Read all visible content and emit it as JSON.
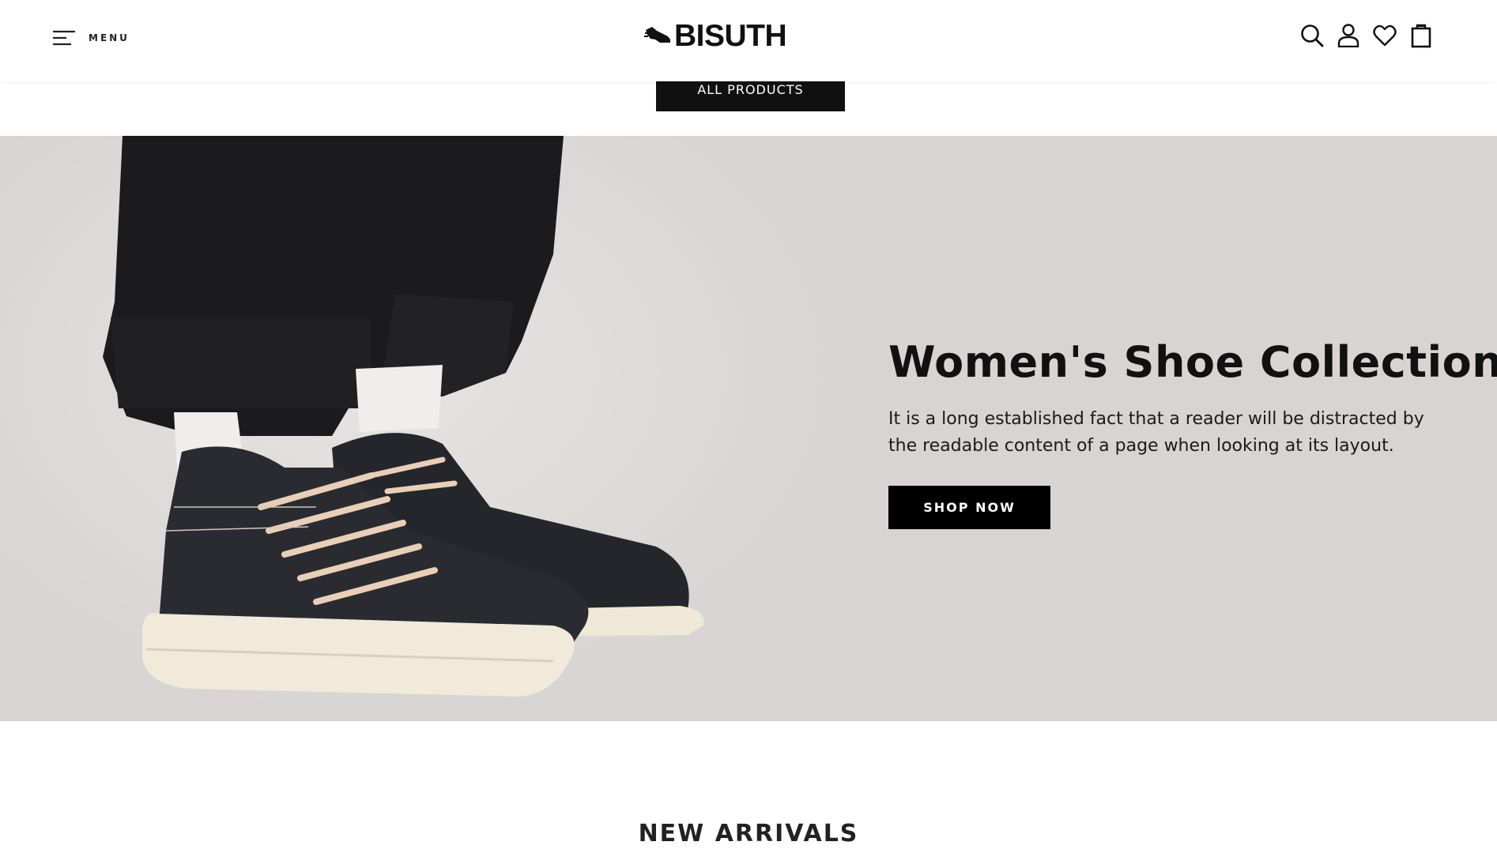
{
  "header": {
    "menu_label": "MENU",
    "logo_text": "BISUTH",
    "icons": [
      "search-icon",
      "user-icon",
      "heart-icon",
      "bag-icon"
    ]
  },
  "all_products_label": "ALL PRODUCTS",
  "hero": {
    "title": "Women's Shoe Collection",
    "description": "It is a long established fact that a reader will be distracted by the readable content of a page when looking at its layout.",
    "button_label": "SHOP NOW",
    "background_color": "#d7d4d3"
  },
  "new_arrivals": {
    "title": "NEW ARRIVALS"
  }
}
